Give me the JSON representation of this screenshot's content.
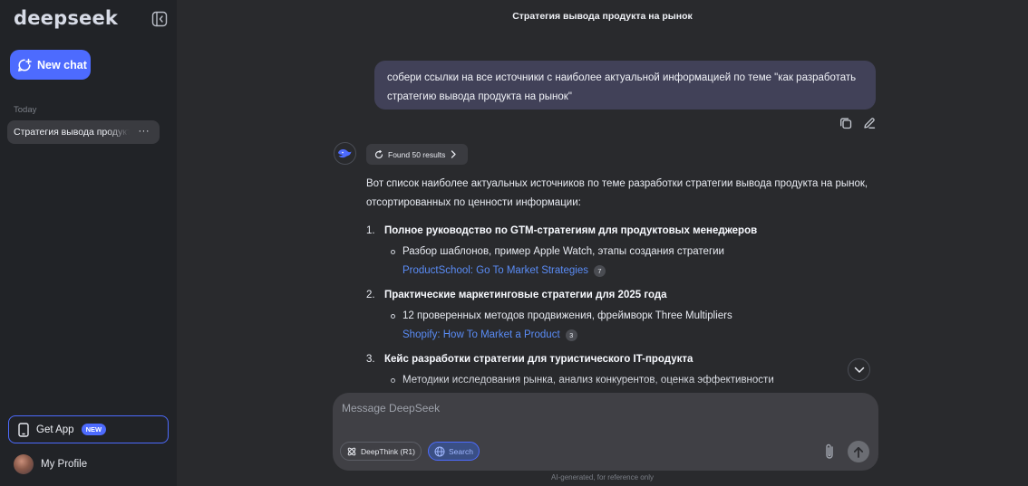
{
  "sidebar": {
    "logo": "deepseek",
    "new_chat_label": "New chat",
    "section_today": "Today",
    "chats": [
      {
        "label": "Стратегия вывода продукта на рынок",
        "more": "···"
      }
    ],
    "get_app_label": "Get App",
    "get_app_badge": "NEW",
    "profile_label": "My Profile"
  },
  "header": {
    "title": "Стратегия вывода продукта на рынок"
  },
  "conversation": {
    "user_message": "собери ссылки на все источники с наиболее актуальной информацией по теме \"как разработать стратегию вывода продукта на рынок\"",
    "found_results": "Found 50 results",
    "intro": "Вот список наиболее актуальных источников по теме разработки стратегии вывода продукта на рынок, отсортированных по ценности информации:",
    "items": [
      {
        "num": "1.",
        "head": "Полное руководство по GTM-стратегиям для продуктовых менеджеров",
        "detail": "Разбор шаблонов, пример Apple Watch, этапы создания стратегии",
        "link": "ProductSchool: Go To Market Strategies",
        "cite": "7"
      },
      {
        "num": "2.",
        "head": "Практические маркетинговые стратегии для 2025 года",
        "detail": "12 проверенных методов продвижения, фреймворк Three Multipliers",
        "link": "Shopify: How To Market a Product",
        "cite": "3"
      },
      {
        "num": "3.",
        "head": "Кейс разработки стратегии для туристического IT-продукта",
        "detail": "Методики исследования рынка, анализ конкурентов, оценка эффективности"
      }
    ]
  },
  "composer": {
    "placeholder": "Message DeepSeek",
    "deepthink_label": "DeepThink (R1)",
    "search_label": "Search",
    "disclaimer": "AI-generated, for reference only"
  },
  "colors": {
    "accent": "#4d6bfe",
    "link": "#5a8cf6",
    "sidebar_bg": "#212327",
    "main_bg": "#292a2d",
    "user_bubble": "#414158"
  }
}
